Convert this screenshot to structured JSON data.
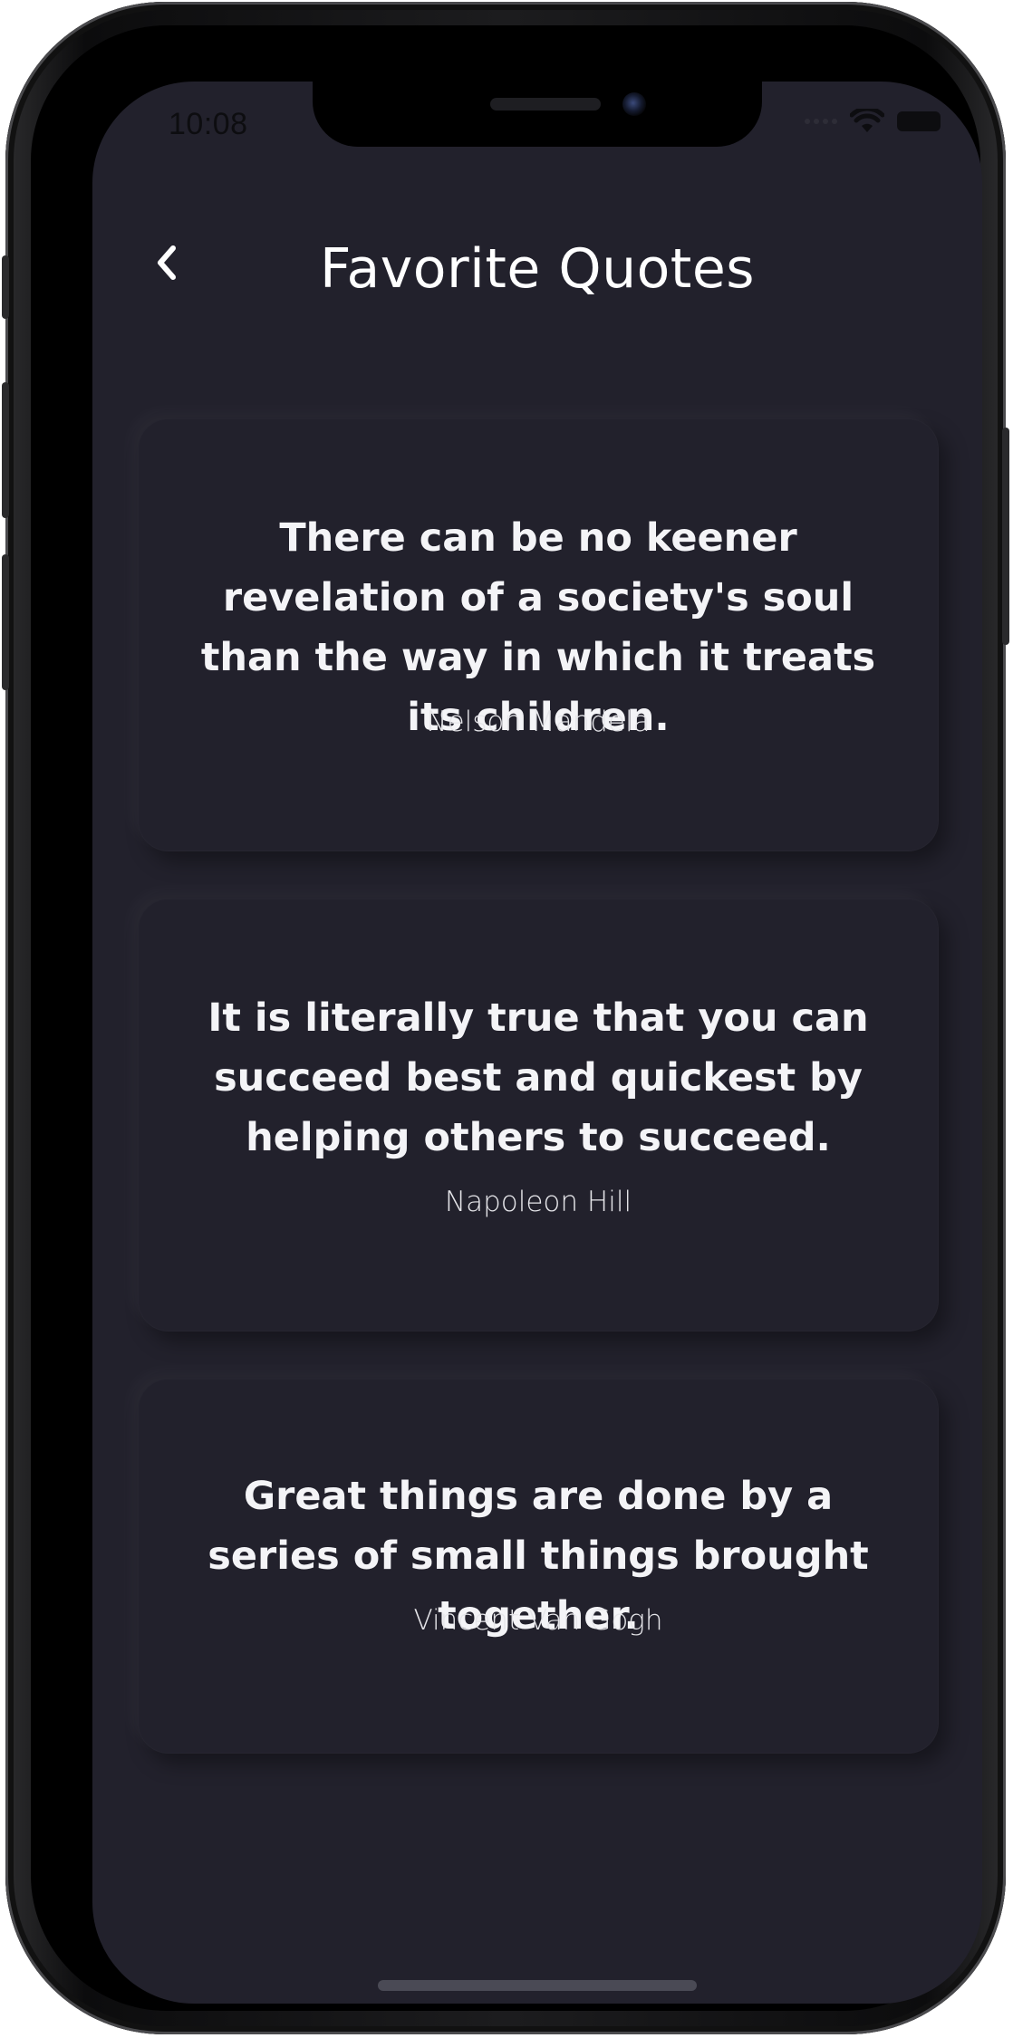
{
  "status_bar": {
    "time": "10:08",
    "wifi_icon": "wifi-icon",
    "battery_icon": "battery-icon"
  },
  "header": {
    "back_icon": "chevron-left-icon",
    "title": "Favorite Quotes"
  },
  "quotes": [
    {
      "text": "There can be no keener revelation of a society's soul than the way in which it treats its children.",
      "author": "Nelson Mandela"
    },
    {
      "text": "It is literally true that you can succeed best and quickest by helping others to succeed.",
      "author": "Napoleon Hill"
    },
    {
      "text": "Great things are done by a series of small things brought together.",
      "author": "Vincent Van Gogh"
    }
  ],
  "colors": {
    "background": "#22212c",
    "text": "#ffffff"
  }
}
